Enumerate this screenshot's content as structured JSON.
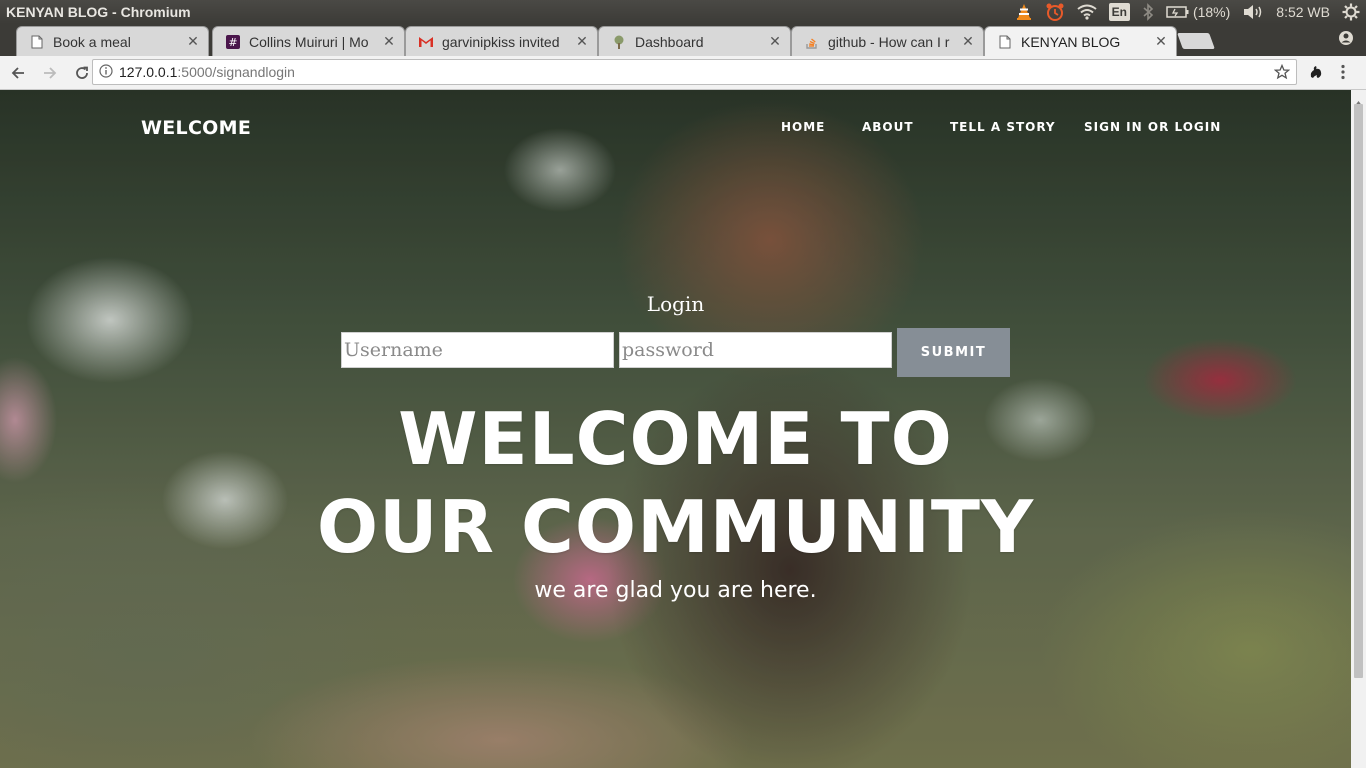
{
  "os": {
    "window_title": "KENYAN BLOG - Chromium",
    "language": "En",
    "battery": "(18%)",
    "clock": "8:52 WB"
  },
  "tabs": [
    {
      "label": "Book a meal",
      "icon": "page-icon",
      "active": false
    },
    {
      "label": "Collins Muiruri | Mo",
      "icon": "slack-icon",
      "active": false
    },
    {
      "label": "garvinipkiss invited",
      "icon": "gmail-icon",
      "active": false
    },
    {
      "label": "Dashboard",
      "icon": "tree-icon",
      "active": false
    },
    {
      "label": "github - How can I r",
      "icon": "stackoverflow-icon",
      "active": false
    },
    {
      "label": "KENYAN BLOG",
      "icon": "page-icon",
      "active": true
    }
  ],
  "toolbar": {
    "url_host": "127.0.0.1",
    "url_path": ":5000/signandlogin"
  },
  "page": {
    "brand": "WELCOME",
    "nav": [
      {
        "label": "HOME"
      },
      {
        "label": "ABOUT"
      },
      {
        "label": "TELL A STORY"
      },
      {
        "label": "SIGN IN OR LOGIN"
      }
    ],
    "login": {
      "title": "Login",
      "username_placeholder": "Username",
      "password_placeholder": "password",
      "submit_label": "SUBMIT"
    },
    "hero": {
      "line1": "WELCOME TO",
      "line2": "OUR COMMUNITY",
      "subtitle": "we are glad you are here."
    }
  },
  "colors": {
    "submit_bg": "#868e96",
    "panel_bg": "#3c3b37",
    "text_white": "#ffffff"
  }
}
